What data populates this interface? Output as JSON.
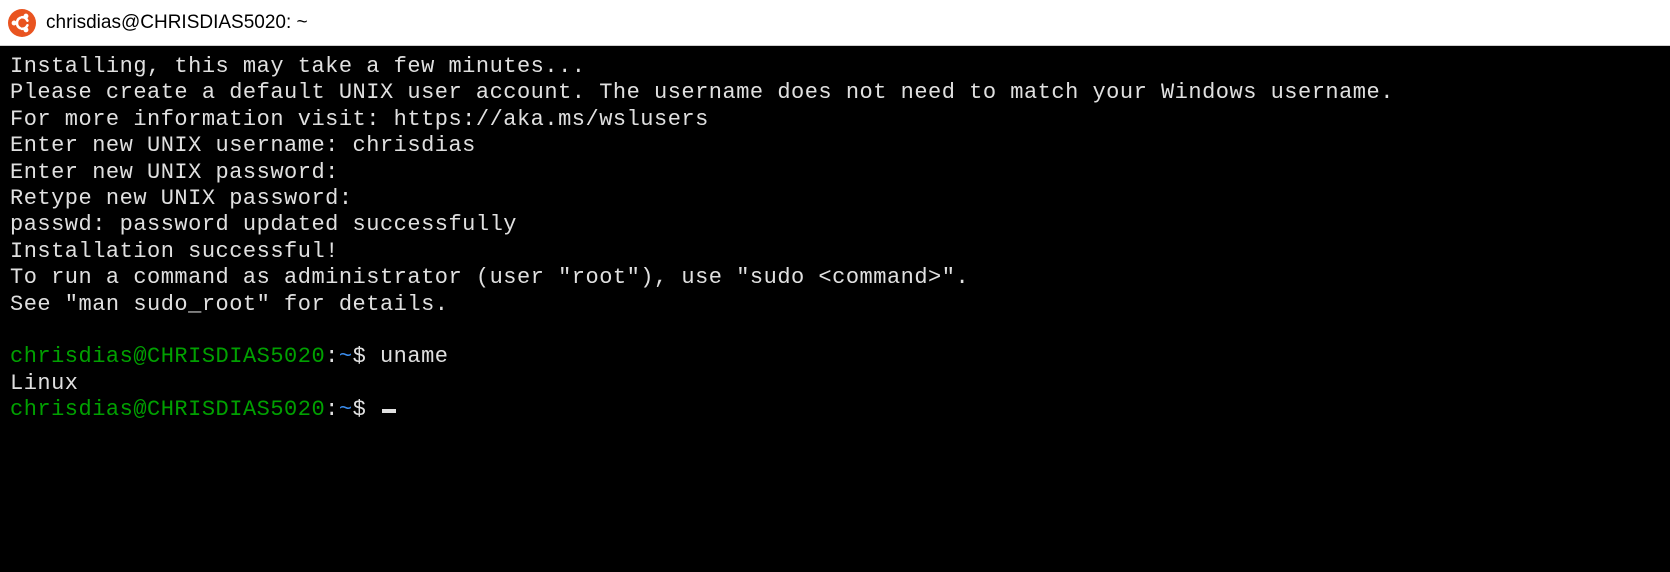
{
  "titlebar": {
    "title": "chrisdias@CHRISDIAS5020: ~"
  },
  "terminal": {
    "lines": [
      "Installing, this may take a few minutes...",
      "Please create a default UNIX user account. The username does not need to match your Windows username.",
      "For more information visit: https://aka.ms/wslusers",
      "Enter new UNIX username: chrisdias",
      "Enter new UNIX password:",
      "Retype new UNIX password:",
      "passwd: password updated successfully",
      "Installation successful!",
      "To run a command as administrator (user \"root\"), use \"sudo <command>\".",
      "See \"man sudo_root\" for details."
    ],
    "prompt1": {
      "user": "chrisdias",
      "host": "CHRISDIAS5020",
      "path": "~",
      "dollar": "$",
      "cmd": "uname"
    },
    "output1": "Linux",
    "prompt2": {
      "user": "chrisdias",
      "host": "CHRISDIAS5020",
      "path": "~",
      "dollar": "$"
    }
  },
  "colors": {
    "prompt_green": "#00a000",
    "path_blue": "#3b8ef0",
    "text_white": "#e0e0e0",
    "bg_black": "#000000",
    "ubuntu_orange": "#E95420"
  }
}
